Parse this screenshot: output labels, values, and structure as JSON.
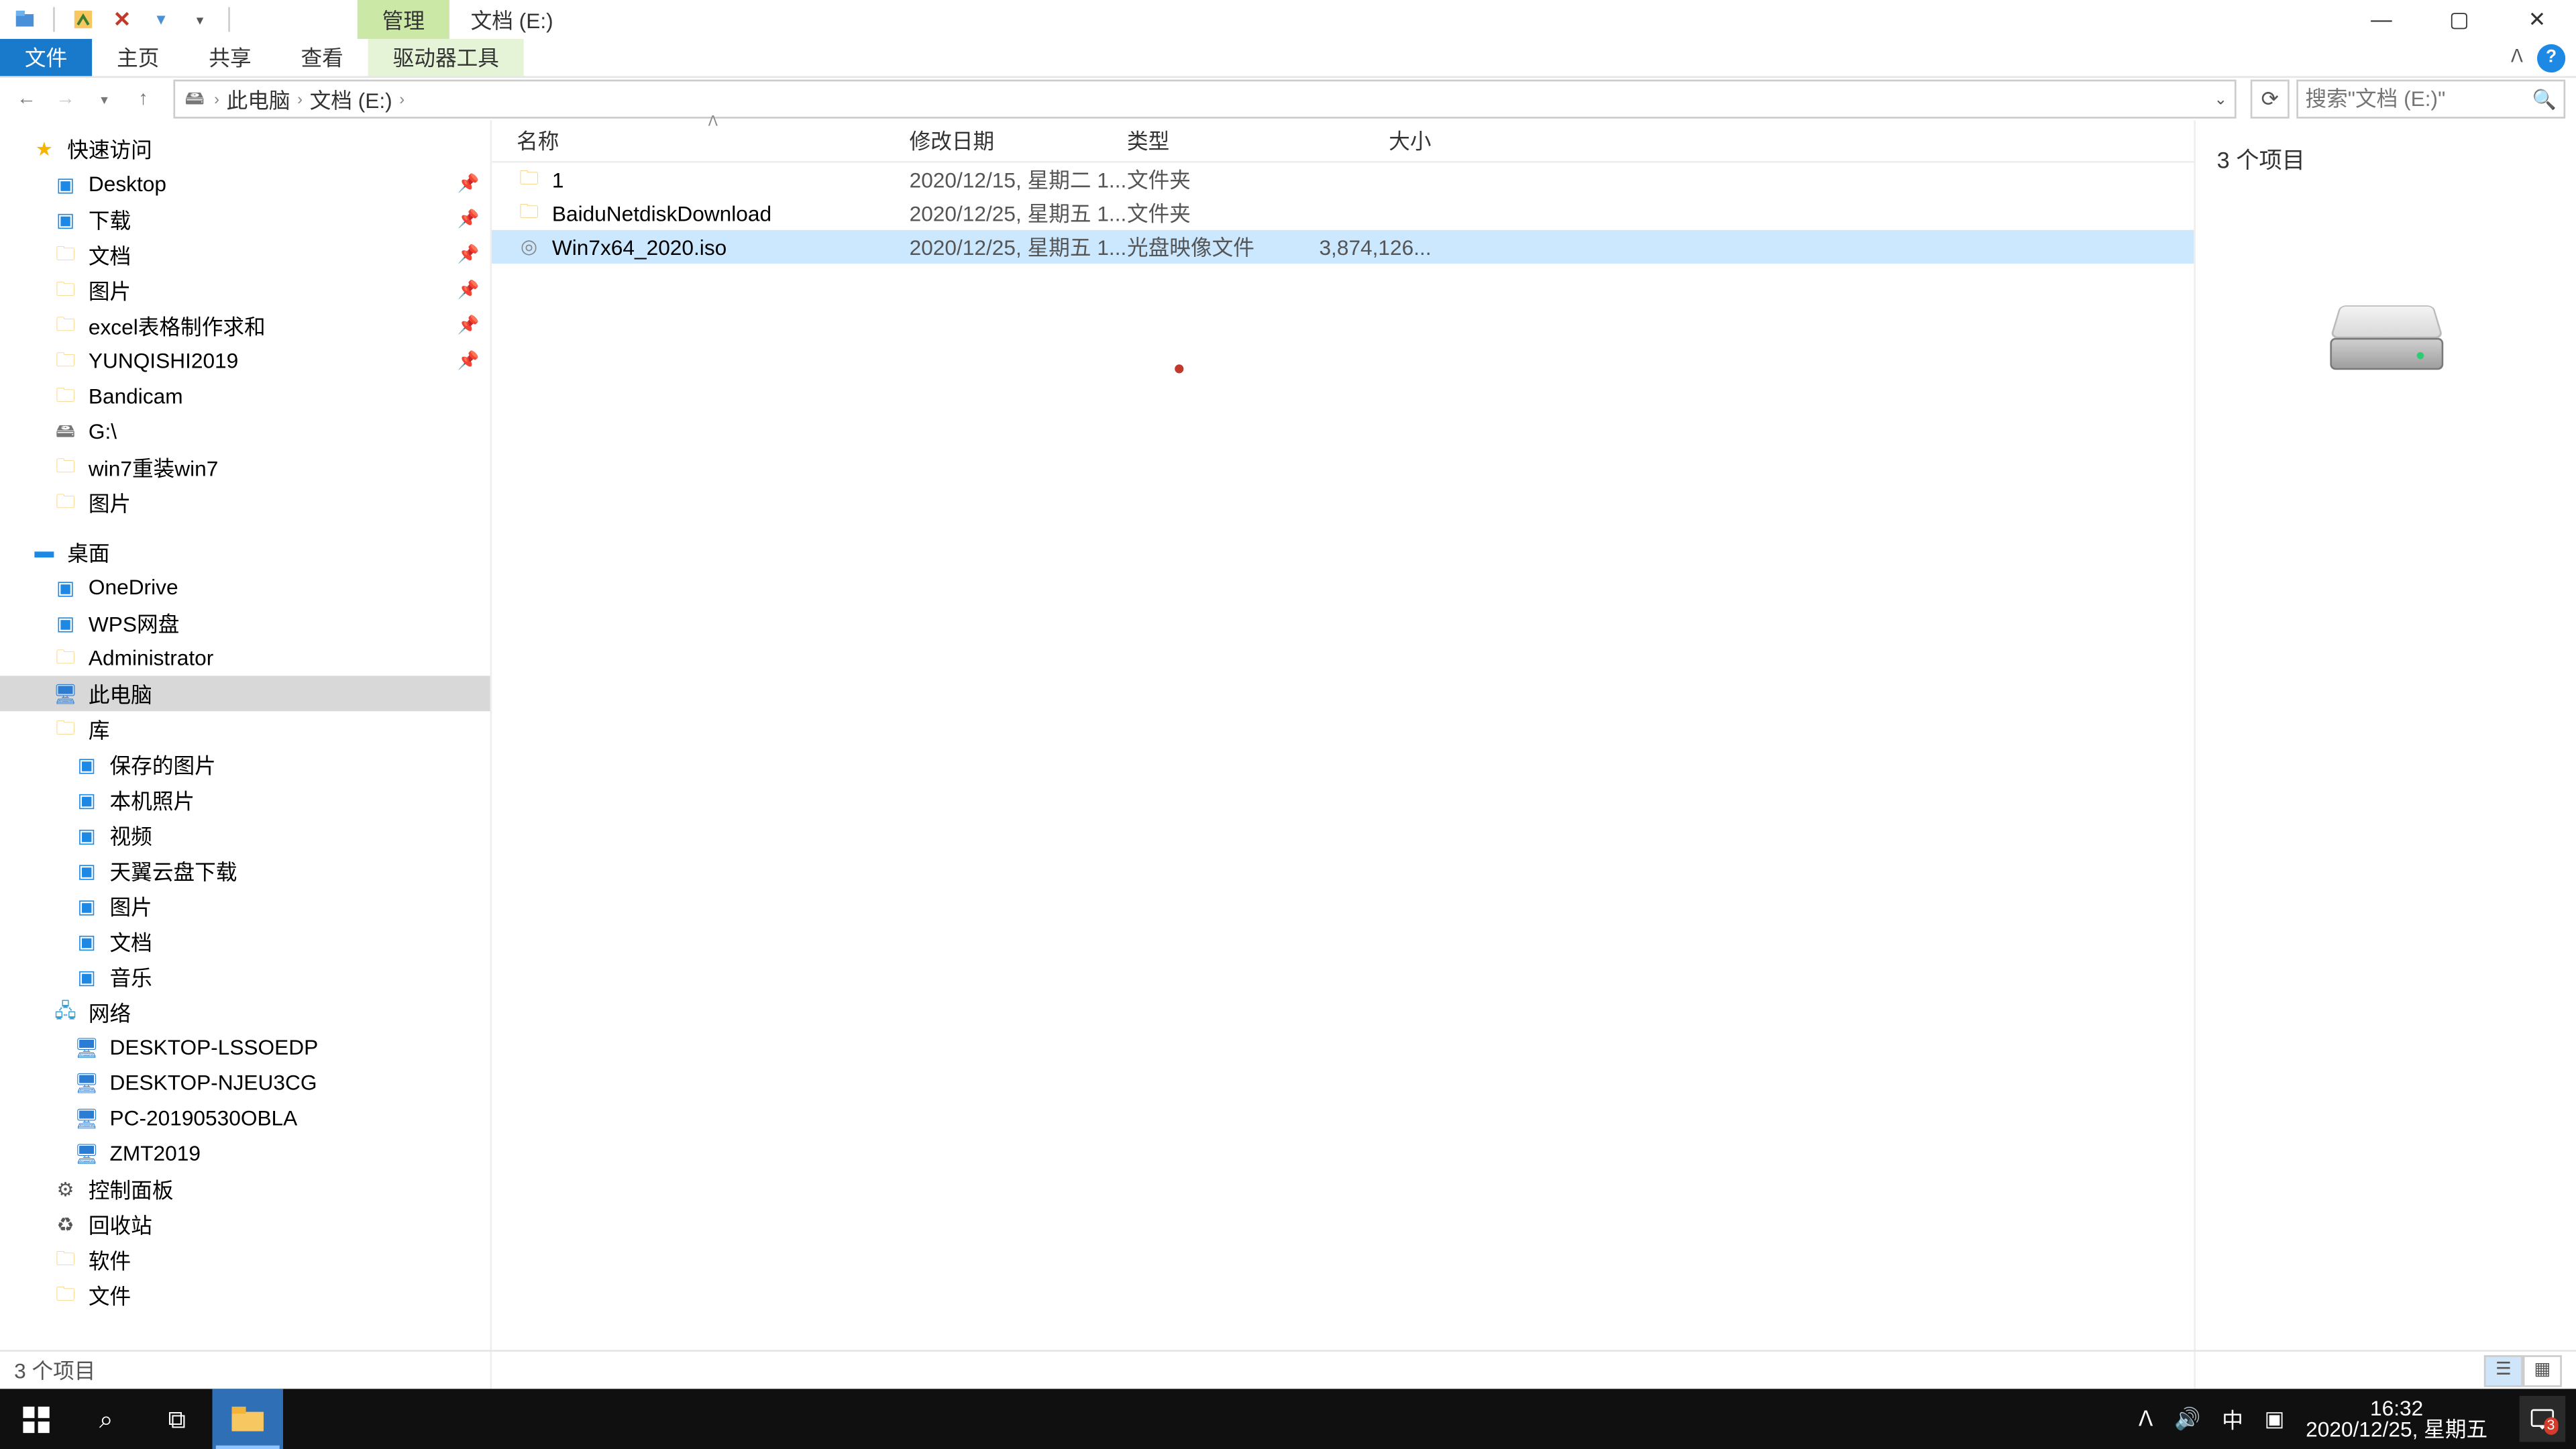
{
  "title_path": "文档 (E:)",
  "ctx_tab": "管理",
  "ribbon": {
    "file": "文件",
    "home": "主页",
    "share": "共享",
    "view": "查看",
    "drive": "驱动器工具"
  },
  "breadcrumb": [
    "此电脑",
    "文档 (E:)"
  ],
  "search_placeholder": "搜索\"文档 (E:)\"",
  "columns": {
    "name": "名称",
    "date": "修改日期",
    "type": "类型",
    "size": "大小"
  },
  "files": [
    {
      "name": "1",
      "date": "2020/12/15, 星期二 1...",
      "type": "文件夹",
      "size": "",
      "icon": "folder",
      "sel": false
    },
    {
      "name": "BaiduNetdiskDownload",
      "date": "2020/12/25, 星期五 1...",
      "type": "文件夹",
      "size": "",
      "icon": "folder",
      "sel": false
    },
    {
      "name": "Win7x64_2020.iso",
      "date": "2020/12/25, 星期五 1...",
      "type": "光盘映像文件",
      "size": "3,874,126...",
      "icon": "iso",
      "sel": true
    }
  ],
  "preview_count": "3 个项目",
  "status_text": "3 个项目",
  "nav": {
    "quick": {
      "label": "快速访问",
      "items": [
        {
          "l": "Desktop",
          "pin": true,
          "i": "blue"
        },
        {
          "l": "下载",
          "pin": true,
          "i": "blue"
        },
        {
          "l": "文档",
          "pin": true,
          "i": "folder"
        },
        {
          "l": "图片",
          "pin": true,
          "i": "folder"
        },
        {
          "l": "excel表格制作求和",
          "pin": true,
          "i": "folder"
        },
        {
          "l": "YUNQISHI2019",
          "pin": true,
          "i": "folder"
        },
        {
          "l": "Bandicam",
          "pin": false,
          "i": "folder"
        },
        {
          "l": "G:\\",
          "pin": false,
          "i": "drive"
        },
        {
          "l": "win7重装win7",
          "pin": false,
          "i": "folder"
        },
        {
          "l": "图片",
          "pin": false,
          "i": "folder"
        }
      ]
    },
    "desktop": {
      "label": "桌面",
      "items": [
        {
          "l": "OneDrive",
          "i": "blue"
        },
        {
          "l": "WPS网盘",
          "i": "blue"
        },
        {
          "l": "Administrator",
          "i": "folder"
        },
        {
          "l": "此电脑",
          "i": "pc",
          "sel": true
        },
        {
          "l": "库",
          "i": "folder"
        }
      ]
    },
    "libs": [
      {
        "l": "保存的图片",
        "i": "blue"
      },
      {
        "l": "本机照片",
        "i": "blue"
      },
      {
        "l": "视频",
        "i": "blue"
      },
      {
        "l": "天翼云盘下载",
        "i": "blue"
      },
      {
        "l": "图片",
        "i": "blue"
      },
      {
        "l": "文档",
        "i": "blue"
      },
      {
        "l": "音乐",
        "i": "blue"
      }
    ],
    "network": {
      "label": "网络",
      "items": [
        {
          "l": "DESKTOP-LSSOEDP"
        },
        {
          "l": "DESKTOP-NJEU3CG"
        },
        {
          "l": "PC-20190530OBLA"
        },
        {
          "l": "ZMT2019"
        }
      ]
    },
    "bottom": [
      {
        "l": "控制面板",
        "i": "cp"
      },
      {
        "l": "回收站",
        "i": "recycle"
      },
      {
        "l": "软件",
        "i": "folder"
      },
      {
        "l": "文件",
        "i": "folder"
      }
    ]
  },
  "clock": {
    "time": "16:32",
    "date": "2020/12/25, 星期五"
  },
  "ime": "中",
  "notif_count": "3"
}
